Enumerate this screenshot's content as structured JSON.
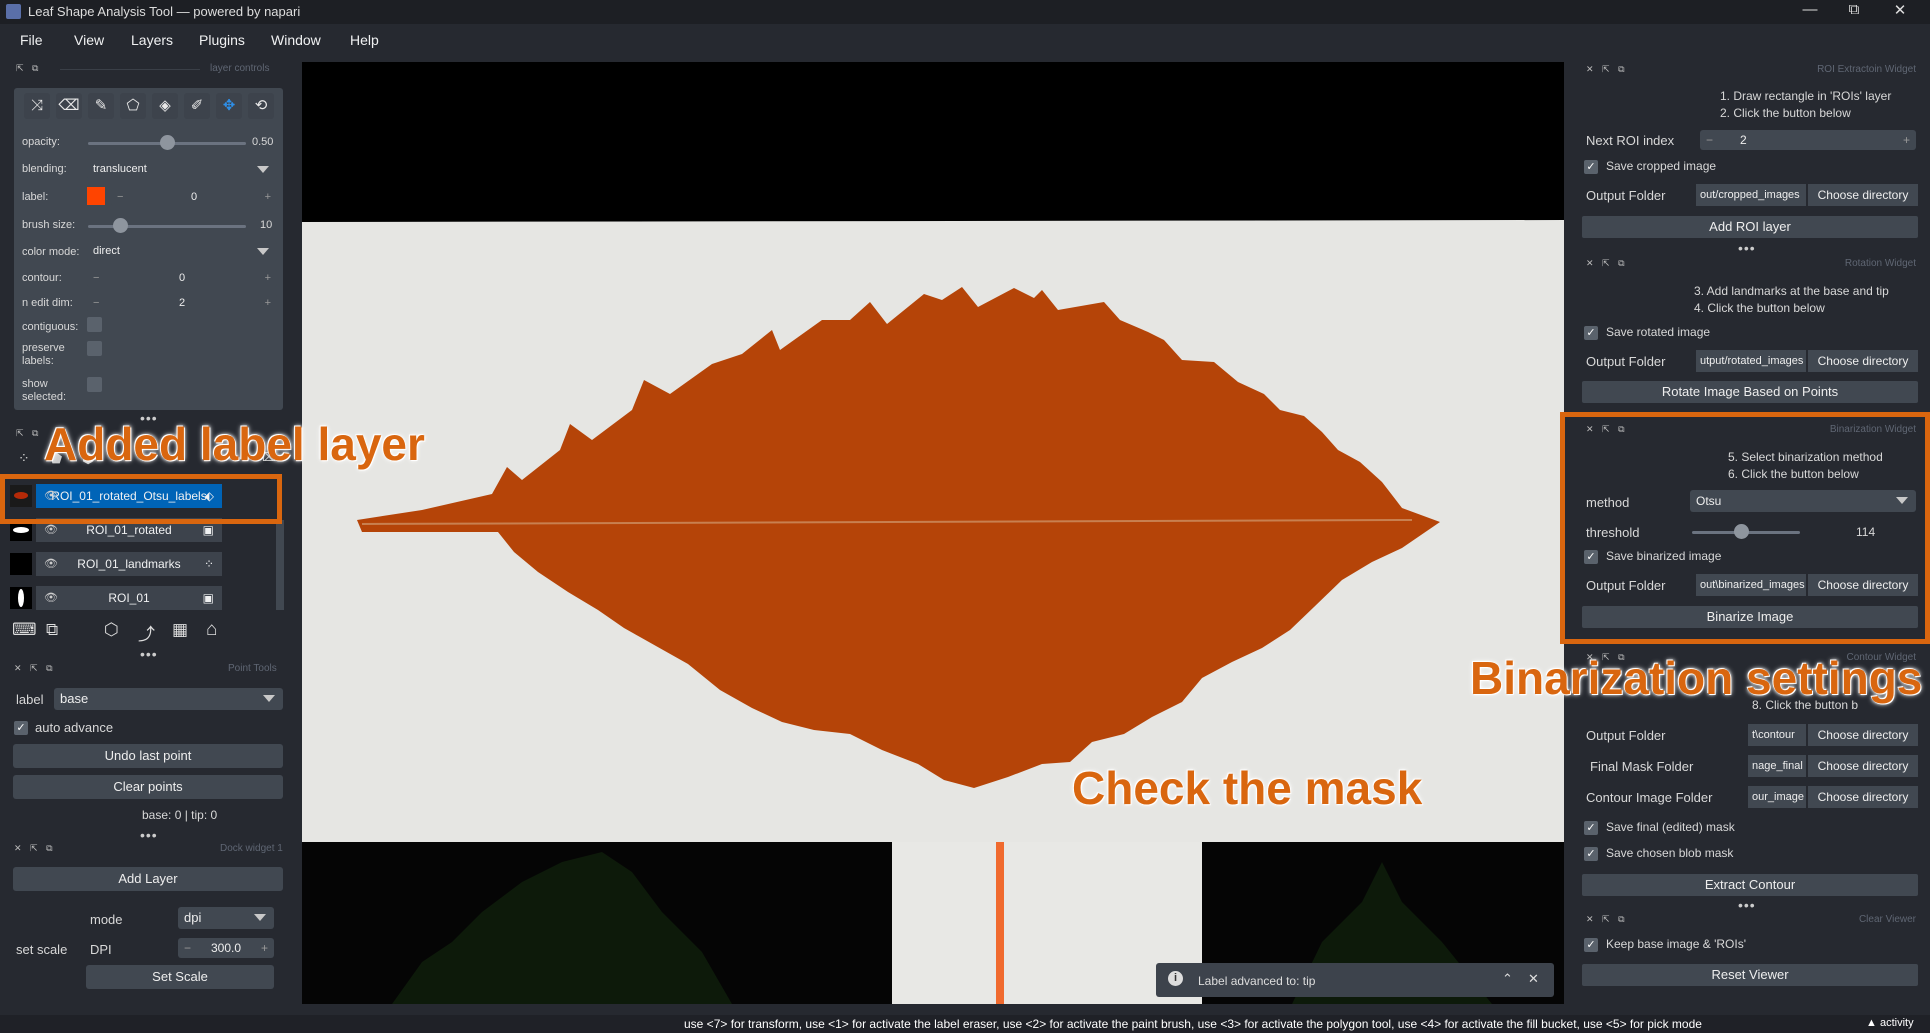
{
  "window": {
    "title": "Leaf Shape Analysis Tool — powered by napari",
    "minimize": "—",
    "restore": "⧉",
    "close": "✕"
  },
  "menu": [
    "File",
    "View",
    "Layers",
    "Plugins",
    "Window",
    "Help"
  ],
  "layer_controls": {
    "header": "layer controls",
    "opacity_label": "opacity:",
    "opacity_value": "0.50",
    "opacity_level": 0.5,
    "blending_label": "blending:",
    "blending_value": "translucent",
    "label_label": "label:",
    "label_value": "0",
    "label_color": "#ff4400",
    "brush_label": "brush size:",
    "brush_value": "10",
    "brush_level": 0.2,
    "colormode_label": "color mode:",
    "colormode_value": "direct",
    "contour_label": "contour:",
    "contour_value": "0",
    "ndim_label": "n edit dim:",
    "ndim_value": "2",
    "contiguous_label": "contiguous:",
    "preserve_label": "preserve labels:",
    "show_label": "show selected:"
  },
  "layers": [
    {
      "name": "ROI_01_rotated_Otsu_labels",
      "selected": true,
      "type_icon": "label-layer-icon"
    },
    {
      "name": "ROI_01_rotated",
      "selected": false,
      "type_icon": "image-layer-icon"
    },
    {
      "name": "ROI_01_landmarks",
      "selected": false,
      "type_icon": "points-layer-icon"
    },
    {
      "name": "ROI_01",
      "selected": false,
      "type_icon": "image-layer-icon"
    }
  ],
  "point_tools": {
    "header": "Point Tools",
    "label_label": "label",
    "label_value": "base",
    "auto_advance": "auto advance",
    "undo": "Undo last point",
    "clear": "Clear points",
    "counts": "base: 0 | tip: 0"
  },
  "dock1": {
    "header": "Dock widget 1",
    "add_layer": "Add Layer",
    "mode_label": "mode",
    "mode_value": "dpi",
    "set_scale_label": "set scale",
    "dpi_label": "DPI",
    "dpi_value": "300.0",
    "set_scale_btn": "Set Scale"
  },
  "roi_widget": {
    "header": "ROI Extractoin Widget",
    "instr1": "1. Draw rectangle in 'ROIs' layer",
    "instr2": "2. Click the button below",
    "next_label": "Next ROI index",
    "next_value": "2",
    "save_cropped": "Save cropped image",
    "output_label": "Output Folder",
    "output_path": "out/cropped_images",
    "choose": "Choose directory",
    "add_roi": "Add ROI layer"
  },
  "rotation_widget": {
    "header": "Rotation Widget",
    "instr1": "3. Add landmarks at the base and tip",
    "instr2": "4. Click the button below",
    "save_rotated": "Save rotated image",
    "output_label": "Output Folder",
    "output_path": "utput/rotated_images",
    "choose": "Choose directory",
    "rotate_btn": "Rotate Image Based on Points"
  },
  "binarization_widget": {
    "header": "Binarization Widget",
    "instr1": "5. Select binarization method",
    "instr2": "6. Click the button below",
    "method_label": "method",
    "method_value": "Otsu",
    "threshold_label": "threshold",
    "threshold_value": "114",
    "threshold_level": 0.45,
    "save_binarized": "Save binarized image",
    "output_label": "Output Folder",
    "output_path": "out\\binarized_images",
    "choose": "Choose directory",
    "binarize_btn": "Binarize Image"
  },
  "contour_widget": {
    "header": "Contour Widget",
    "instr2": "8. Click the button b",
    "output_label": "Output Folder",
    "output_path": "t\\contour",
    "final_mask_label": "Final Mask Folder",
    "final_mask_path": "nage_final",
    "contour_image_label": "Contour Image Folder",
    "contour_image_path": "our_image",
    "choose": "Choose directory",
    "save_final": "Save final (edited) mask",
    "save_blob": "Save chosen blob mask",
    "extract_btn": "Extract Contour"
  },
  "clear_viewer": {
    "header": "Clear Viewer",
    "keep": "Keep base image & 'ROIs'",
    "reset": "Reset Viewer"
  },
  "annotations": {
    "added_label": "Added label layer",
    "binarization": "Binarization settings",
    "check_mask": "Check the mask"
  },
  "notification": {
    "text": "Label advanced to: tip",
    "info_icon": "info-icon"
  },
  "status": {
    "text": "use <7> for transform, use <1> for activate the label eraser, use <2> for activate the paint brush, use <3> for activate the polygon tool, use <4> for activate the fill bucket, use <5> for pick mode",
    "activity": "activity"
  },
  "colors": {
    "leaf": "#b54408",
    "accent": "#d9660f",
    "selected_layer": "#0064b7",
    "background": "#262930"
  }
}
